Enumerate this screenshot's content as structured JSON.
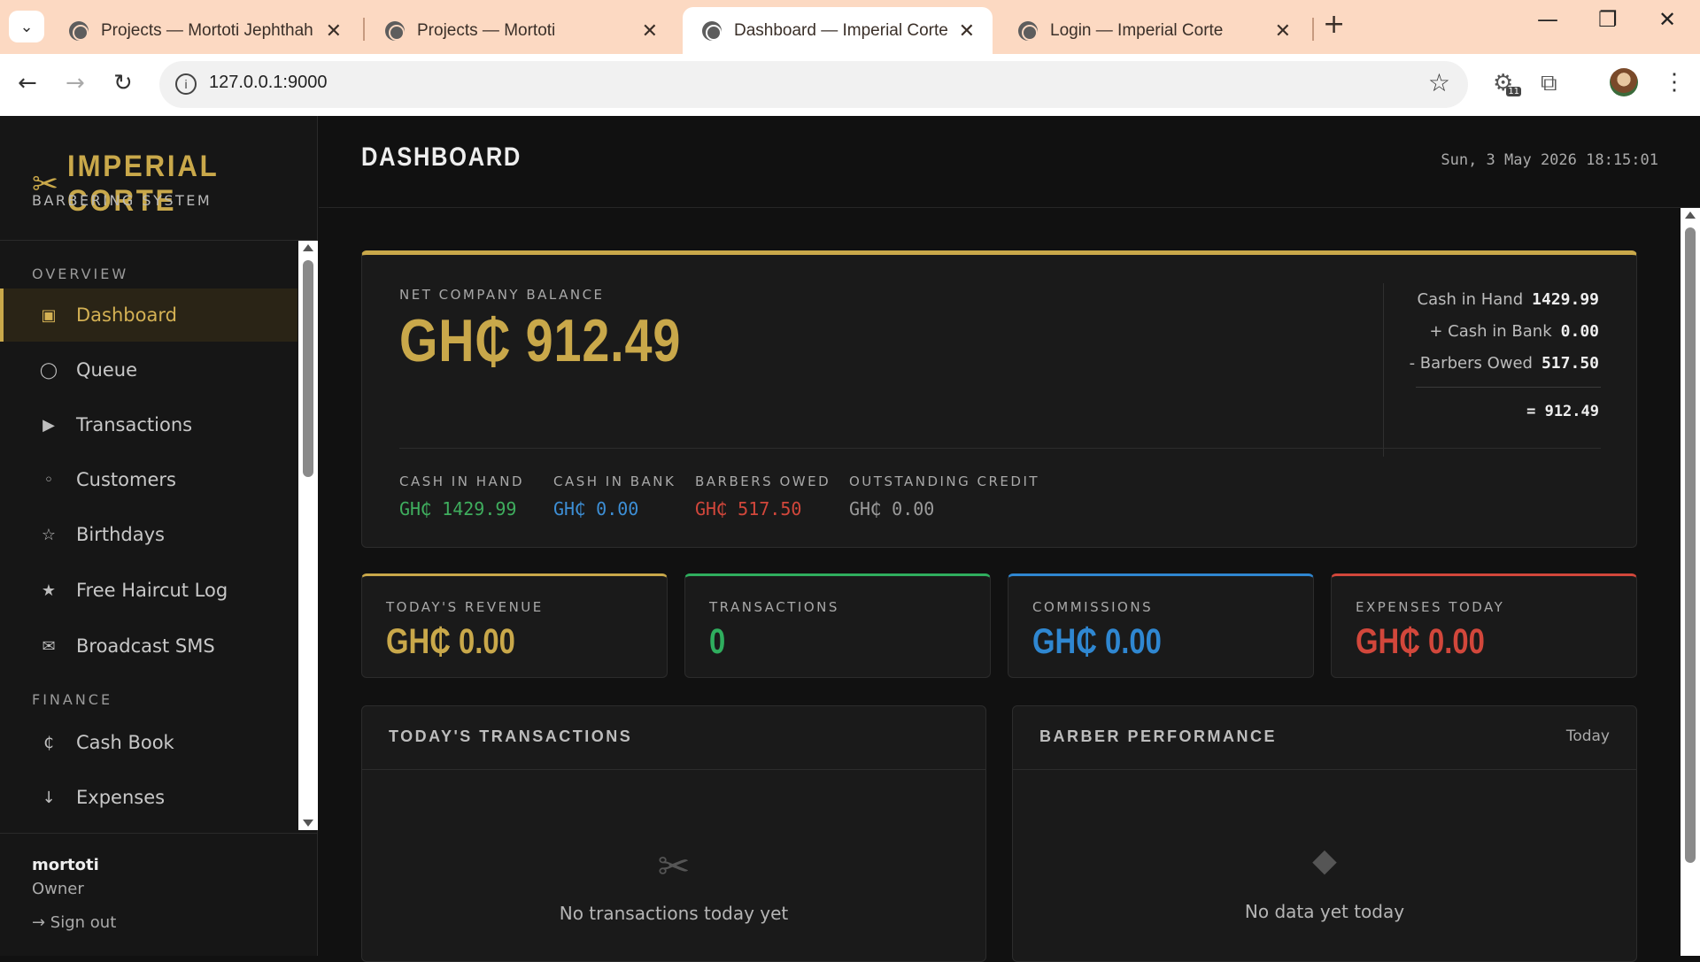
{
  "browser": {
    "tabs": [
      {
        "title": "Projects — Mortoti Jephthah",
        "active": false
      },
      {
        "title": "Projects — Mortoti",
        "active": false
      },
      {
        "title": "Dashboard — Imperial Corte",
        "active": true
      },
      {
        "title": "Login — Imperial Corte",
        "active": false
      }
    ],
    "url": "127.0.0.1:9000",
    "extension_badge": "11"
  },
  "brand": {
    "name": "IMPERIAL CORTE",
    "subtitle": "BARBERING SYSTEM",
    "icon": "scissors-icon"
  },
  "sidebar": {
    "sections": [
      "OVERVIEW",
      "FINANCE"
    ],
    "items": [
      {
        "label": "Dashboard",
        "icon": "square-icon",
        "glyph": "▣",
        "active": true
      },
      {
        "label": "Queue",
        "icon": "circle-icon",
        "glyph": "◯"
      },
      {
        "label": "Transactions",
        "icon": "play-icon",
        "glyph": "▶"
      },
      {
        "label": "Customers",
        "icon": "dot-icon",
        "glyph": "◦"
      },
      {
        "label": "Birthdays",
        "icon": "star-outline-icon",
        "glyph": "☆"
      },
      {
        "label": "Free Haircut Log",
        "icon": "star-icon",
        "glyph": "★"
      },
      {
        "label": "Broadcast SMS",
        "icon": "envelope-icon",
        "glyph": "✉"
      },
      {
        "label": "Cash Book",
        "icon": "cedi-icon",
        "glyph": "₵"
      },
      {
        "label": "Expenses",
        "icon": "arrow-down-icon",
        "glyph": "↓"
      }
    ]
  },
  "user": {
    "name": "mortoti",
    "role": "Owner",
    "signout": "→ Sign out"
  },
  "header": {
    "title": "DASHBOARD",
    "datetime": "Sun, 3 May 2026 18:15:01"
  },
  "balance": {
    "label": "NET COMPANY BALANCE",
    "value": "GH₵ 912.49",
    "calc": [
      {
        "label": "Cash in Hand",
        "value": "1429.99"
      },
      {
        "label": "+ Cash in Bank",
        "value": "0.00"
      },
      {
        "label": "- Barbers Owed",
        "value": "517.50"
      }
    ],
    "total": "= 912.49",
    "breakdown": [
      {
        "label": "CASH IN HAND",
        "value": "GH₵ 1429.99",
        "color": "#3fae5e"
      },
      {
        "label": "CASH IN BANK",
        "value": "GH₵ 0.00",
        "color": "#3d8fd6"
      },
      {
        "label": "BARBERS OWED",
        "value": "GH₵ 517.50",
        "color": "#d2473b"
      },
      {
        "label": "OUTSTANDING CREDIT",
        "value": "GH₵ 0.00",
        "color": "#9a9a9a"
      }
    ]
  },
  "stats": [
    {
      "label": "TODAY'S REVENUE",
      "value": "GH₵ 0.00",
      "color": "#c9a84a"
    },
    {
      "label": "TRANSACTIONS",
      "value": "0",
      "color": "#2fae5e"
    },
    {
      "label": "COMMISSIONS",
      "value": "GH₵ 0.00",
      "color": "#2f87d1"
    },
    {
      "label": "EXPENSES TODAY",
      "value": "GH₵ 0.00",
      "color": "#d2473b"
    }
  ],
  "panels": {
    "transactions": {
      "title": "TODAY'S TRANSACTIONS",
      "empty_icon": "scissors-icon",
      "empty_text": "No transactions today yet"
    },
    "performance": {
      "title": "BARBER PERFORMANCE",
      "filter": "Today",
      "empty_icon": "diamond-icon",
      "empty_text": "No data yet today"
    }
  }
}
